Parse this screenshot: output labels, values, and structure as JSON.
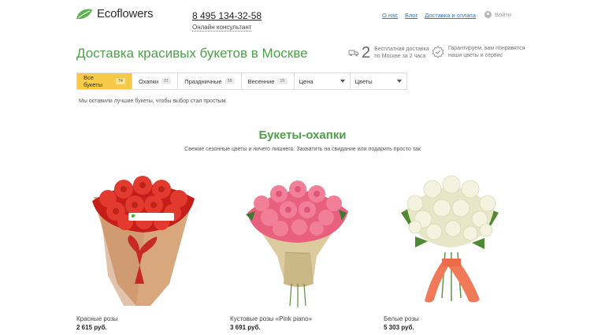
{
  "header": {
    "logo_text": "Ecoflowers",
    "phone": "8 495 134-32-58",
    "consultant": "Онлайн консультант",
    "nav": [
      "О нас",
      "Блог",
      "Доставка и оплата"
    ],
    "login": "Войти"
  },
  "page": {
    "title": "Доставка красивых букетов в Москве",
    "promo_number": "2",
    "promo_line1": "Бесплатная доставка",
    "promo_line2": "по Москве за 2 часа",
    "guarantee_line1": "Гарантируем, вам понравятся",
    "guarantee_line2": "наши цветы и сервис"
  },
  "filters": {
    "tabs": [
      {
        "label": "Все букеты",
        "count": "74",
        "active": true
      },
      {
        "label": "Охапки",
        "count": "21",
        "active": false
      },
      {
        "label": "Праздничные",
        "count": "38",
        "active": false
      },
      {
        "label": "Весенние",
        "count": "15",
        "active": false
      }
    ],
    "price_select": "Цена",
    "color_select": "Цветы"
  },
  "note": "Мы оставили лучшие букеты, чтобы выбор стал простым.",
  "section": {
    "title": "Букеты-охапки",
    "subtitle": "Свежие сезонные цветы и ничего лишнего. Захватить на свидание или подарить просто так"
  },
  "products": [
    {
      "name": "Красные розы",
      "price": "2 615 руб.",
      "flower_color": "#d82a22",
      "wrap_color": "#d9a77c",
      "tag": "Ecoflowers"
    },
    {
      "name": "Кустовые розы «Pink piano»",
      "price": "3 691 руб.",
      "flower_color": "#e8607e",
      "wrap_color": "#dccb9e"
    },
    {
      "name": "Белые розы",
      "price": "5 303 руб.",
      "flower_color": "#f1f0da",
      "ribbon_color": "#f07a58"
    }
  ],
  "colors": {
    "brand_green": "#4ea04a",
    "link_blue": "#3a74b5",
    "active_tab": "#f7c948"
  }
}
